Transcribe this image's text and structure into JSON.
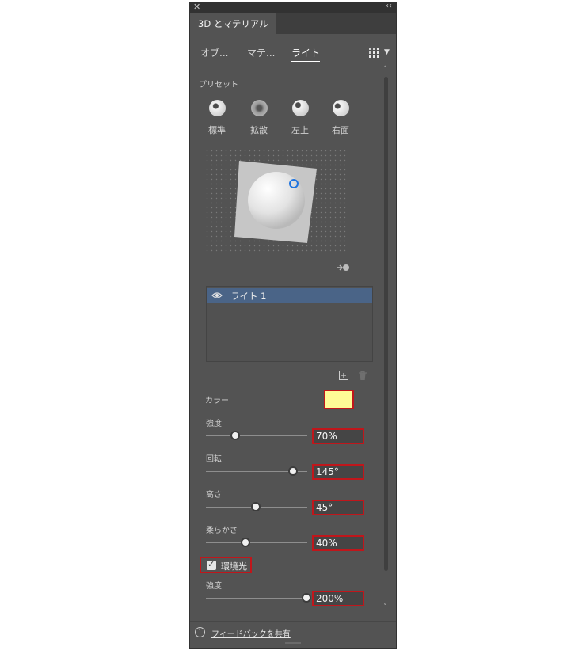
{
  "panel": {
    "title": "3D とマテリアル"
  },
  "subtabs": [
    {
      "label": "オブ..."
    },
    {
      "label": "マテ..."
    },
    {
      "label": "ライト",
      "active": true
    }
  ],
  "presets": {
    "heading": "プリセット",
    "items": [
      {
        "label": "標準"
      },
      {
        "label": "拡散"
      },
      {
        "label": "左上"
      },
      {
        "label": "右面"
      }
    ]
  },
  "lights": {
    "items": [
      {
        "label": "ライト 1",
        "visible": true,
        "selected": true
      }
    ]
  },
  "properties": {
    "color_label": "カラー",
    "color_value": "#fffb96",
    "intensity": {
      "label": "強度",
      "value": "70%",
      "fraction": 0.3
    },
    "rotation": {
      "label": "回転",
      "value": "145°",
      "fraction": 0.87
    },
    "height": {
      "label": "高さ",
      "value": "45°",
      "fraction": 0.5
    },
    "softness": {
      "label": "柔らかさ",
      "value": "40%",
      "fraction": 0.4
    },
    "ambient": {
      "label": "環境光",
      "checked": true
    },
    "ambient_intensity": {
      "label": "強度",
      "value": "200%",
      "fraction": 1.0
    }
  },
  "footer": {
    "feedback": "フィードバックを共有"
  },
  "colors": {
    "panel_bg": "#535353",
    "selection": "#4a6487",
    "highlight_border": "#c0161b",
    "light_handle": "#1f74e0"
  },
  "icons": [
    "close-icon",
    "collapse-icon",
    "grid-icon",
    "chevron-down-icon",
    "eye-icon",
    "add-light-icon",
    "trash-icon",
    "move-light-icon",
    "info-icon"
  ]
}
